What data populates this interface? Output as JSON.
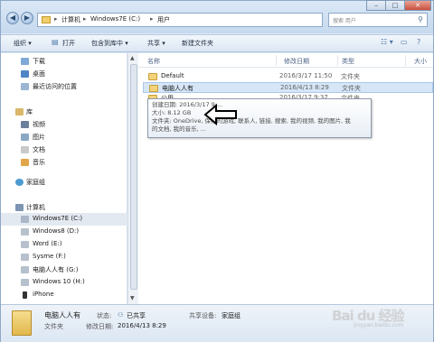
{
  "address": {
    "crumbs": [
      "计算机",
      "Windows7E (C:)",
      "用户"
    ],
    "separator": "▸"
  },
  "search": {
    "placeholder": "搜索 用户"
  },
  "toolbar": {
    "organize": "组织 ▾",
    "open": "打开",
    "include": "包含到库中 ▾",
    "share": "共享 ▾",
    "new_folder": "新建文件夹"
  },
  "nav": {
    "favorites": [
      {
        "label": "下载",
        "icon": "download-folder-icon"
      },
      {
        "label": "桌面",
        "icon": "desktop-icon"
      },
      {
        "label": "最近访问的位置",
        "icon": "recent-places-icon"
      }
    ],
    "libraries_label": "库",
    "libraries": [
      {
        "label": "视频",
        "icon": "video-library-icon"
      },
      {
        "label": "图片",
        "icon": "pictures-library-icon"
      },
      {
        "label": "文档",
        "icon": "documents-library-icon"
      },
      {
        "label": "音乐",
        "icon": "music-library-icon"
      }
    ],
    "homegroup_label": "家庭组",
    "computer_label": "计算机",
    "drives": [
      {
        "label": "Windows7E (C:)",
        "selected": true
      },
      {
        "label": "Windows8 (D:)",
        "selected": false
      },
      {
        "label": "Word (E:)",
        "selected": false
      },
      {
        "label": "Sysme (F:)",
        "selected": false
      },
      {
        "label": "电脑人人有 (G:)",
        "selected": false
      },
      {
        "label": "Windows 10 (H:)",
        "selected": false
      },
      {
        "label": "iPhone",
        "selected": false
      }
    ]
  },
  "columns": {
    "name": "名称",
    "date": "修改日期",
    "type": "类型",
    "size": "大小"
  },
  "files": [
    {
      "name": "Default",
      "date": "2016/3/17 11:50",
      "type": "文件夹",
      "selected": false
    },
    {
      "name": "电脑人人有",
      "date": "2016/4/13 8:29",
      "type": "文件夹",
      "selected": true
    },
    {
      "name": "公用",
      "date": "2016/3/17 9:37",
      "type": "文件夹",
      "selected": false
    }
  ],
  "tooltip": {
    "created": "创建日期: 2016/3/17 9:...",
    "size": "大小: 8.12 GB",
    "files_line1": "文件夹: OneDrive, 保存的游戏, 联系人, 链接, 搜索, 我的视频, 我的图片, 我",
    "files_line2": "的文档, 我的音乐, ..."
  },
  "details": {
    "name": "电脑人人有",
    "type": "文件夹",
    "state_label": "状态:",
    "state_value": "已共享",
    "date_label": "修改日期:",
    "date_value": "2016/4/13 8:29",
    "share_label": "共享设备:",
    "share_value": "家庭组"
  },
  "watermark": {
    "main": "Bai du 经验",
    "sub": "jingyan.baidu.com"
  },
  "colors": {
    "accent": "#3d6a9a",
    "folder": "#f3d37a",
    "selection": "#d6e6f7"
  }
}
